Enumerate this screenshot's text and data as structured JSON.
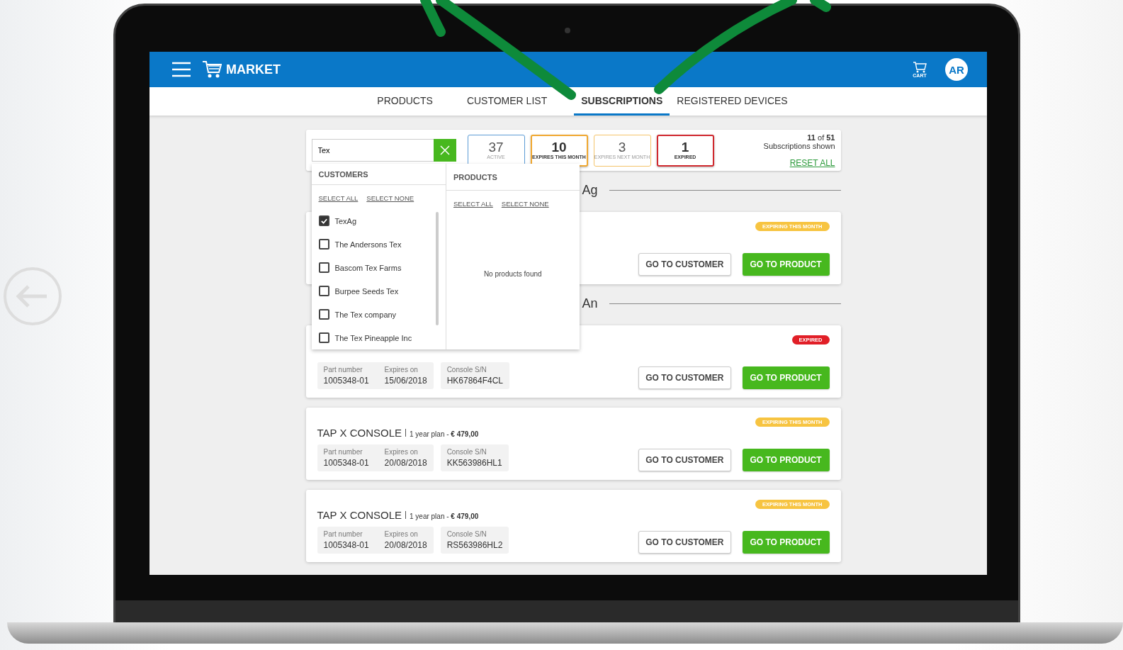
{
  "app": {
    "brand": "MARKET",
    "cart_label": "CART",
    "avatar": "AR"
  },
  "tabs": [
    {
      "label": "PRODUCTS",
      "selected": false
    },
    {
      "label": "CUSTOMER LIST",
      "selected": false
    },
    {
      "label": "SUBSCRIPTIONS",
      "selected": true
    },
    {
      "label": "REGISTERED DEVICES",
      "selected": false
    }
  ],
  "search": {
    "value": "Tex"
  },
  "stats": [
    {
      "count": "37",
      "label": "ACTIVE",
      "color": "#5b9bd5",
      "selected": false
    },
    {
      "count": "10",
      "label": "EXPIRES THIS MONTH",
      "color": "#f0a830",
      "selected": true
    },
    {
      "count": "3",
      "label": "EXPIRES NEXT MONTH",
      "color": "#f5c46a",
      "selected": false
    },
    {
      "count": "1",
      "label": "EXPIRED",
      "color": "#d0282e",
      "selected": true
    }
  ],
  "summary": {
    "text": "**11** of **51**",
    "caption": "Subscriptions shown",
    "reset": "RESET ALL"
  },
  "dropdown": {
    "customers": {
      "title": "CUSTOMERS",
      "select_all": "SELECT ALL",
      "select_none": "SELECT NONE",
      "items": [
        {
          "label": "TexAg",
          "checked": true
        },
        {
          "label": "The Andersons Tex",
          "checked": false
        },
        {
          "label": "Bascom Tex Farms",
          "checked": false
        },
        {
          "label": "Burpee Seeds Tex",
          "checked": false
        },
        {
          "label": "The Tex company",
          "checked": false
        },
        {
          "label": "The Tex Pineapple Inc",
          "checked": false
        }
      ]
    },
    "products": {
      "title": "PRODUCTS",
      "select_all": "SELECT ALL",
      "select_none": "SELECT NONE",
      "empty": "No products found"
    }
  },
  "sections": [
    {
      "name": "Ag",
      "cards": [
        {
          "status": {
            "kind": "expiring",
            "label": "EXPIRING THIS MONTH"
          },
          "buttons": [
            "GO TO CUSTOMER",
            "GO TO PRODUCT"
          ]
        }
      ]
    },
    {
      "name": "An",
      "cards": [
        {
          "status": {
            "kind": "expired",
            "label": "EXPIRED"
          },
          "fields": [
            [
              {
                "label": "Part number",
                "value": "1005348-01"
              },
              {
                "label": "Expires on",
                "value": "15/06/2018"
              }
            ],
            [
              {
                "label": "Console S/N",
                "value": "HK67864F4CL"
              }
            ]
          ],
          "buttons": [
            "GO TO CUSTOMER",
            "GO TO PRODUCT"
          ]
        },
        {
          "title": "TAP X CONSOLE",
          "plan": "1 year plan - **€ 479,00**",
          "status": {
            "kind": "expiring",
            "label": "EXPIRING THIS MONTH"
          },
          "fields": [
            [
              {
                "label": "Part number",
                "value": "1005348-01"
              },
              {
                "label": "Expires on",
                "value": "20/08/2018"
              }
            ],
            [
              {
                "label": "Console S/N",
                "value": "KK563986HL1"
              }
            ]
          ],
          "buttons": [
            "GO TO CUSTOMER",
            "GO TO PRODUCT"
          ]
        },
        {
          "title": "TAP X CONSOLE",
          "plan": "1 year plan - **€ 479,00**",
          "status": {
            "kind": "expiring",
            "label": "EXPIRING THIS MONTH"
          },
          "fields": [
            [
              {
                "label": "Part number",
                "value": "1005348-01"
              },
              {
                "label": "Expires on",
                "value": "20/08/2018"
              }
            ],
            [
              {
                "label": "Console S/N",
                "value": "RS563986HL2"
              }
            ]
          ],
          "buttons": [
            "GO TO CUSTOMER",
            "GO TO PRODUCT"
          ]
        }
      ]
    }
  ]
}
